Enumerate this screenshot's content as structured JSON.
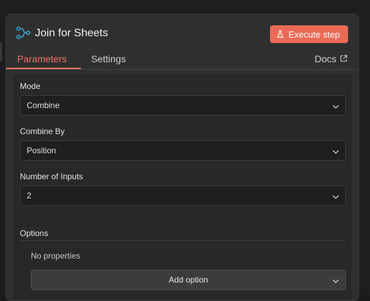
{
  "node": {
    "title": "Join for Sheets",
    "icon": "merge-node-icon"
  },
  "header": {
    "execute_label": "Execute step",
    "execute_icon": "flask-icon"
  },
  "tabs": [
    {
      "label": "Parameters",
      "active": true
    },
    {
      "label": "Settings",
      "active": false
    }
  ],
  "docs": {
    "label": "Docs",
    "icon": "external-link-icon"
  },
  "fields": {
    "mode": {
      "label": "Mode",
      "value": "Combine"
    },
    "combine_by": {
      "label": "Combine By",
      "value": "Position"
    },
    "number_of_inputs": {
      "label": "Number of Inputs",
      "value": "2"
    }
  },
  "options": {
    "label": "Options",
    "empty_text": "No properties",
    "add_label": "Add option"
  },
  "colors": {
    "accent": "#ea6a55",
    "tab_active": "#ef7660",
    "node_icon": "#3ba3c8"
  }
}
